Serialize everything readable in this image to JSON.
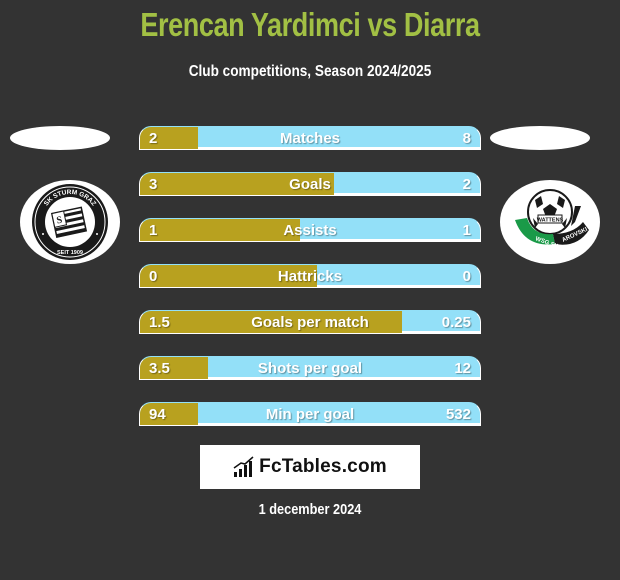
{
  "header": {
    "title": "Erencan Yardimci vs Diarra",
    "subtitle": "Club competitions, Season 2024/2025"
  },
  "teams": {
    "left": {
      "name": "SK Sturm Graz",
      "badge_top": "SK STURM GRAZ",
      "badge_bottom": "SEIT 1909",
      "icon": "sturm-graz-logo-icon"
    },
    "right": {
      "name": "WSG Swarovski Wattens",
      "badge_top": "WATTENS",
      "badge_bottom": "WSG SWAROVSKI",
      "icon": "wsg-wattens-logo-icon"
    }
  },
  "colors": {
    "left_bar": "#b8a11f",
    "right_bar": "#93e0f8",
    "title": "#a2c044",
    "background": "#333333"
  },
  "stats": [
    {
      "label": "Matches",
      "left": "2",
      "right": "8",
      "left_share": 0.17
    },
    {
      "label": "Goals",
      "left": "3",
      "right": "2",
      "left_share": 0.57
    },
    {
      "label": "Assists",
      "left": "1",
      "right": "1",
      "left_share": 0.47
    },
    {
      "label": "Hattricks",
      "left": "0",
      "right": "0",
      "left_share": 0.52
    },
    {
      "label": "Goals per match",
      "left": "1.5",
      "right": "0.25",
      "left_share": 0.77
    },
    {
      "label": "Shots per goal",
      "left": "3.5",
      "right": "12",
      "left_share": 0.2
    },
    {
      "label": "Min per goal",
      "left": "94",
      "right": "532",
      "left_share": 0.17
    }
  ],
  "footer": {
    "brand": "FcTables.com",
    "brand_icon": "bar-chart-growth-icon",
    "date": "1 december 2024"
  }
}
